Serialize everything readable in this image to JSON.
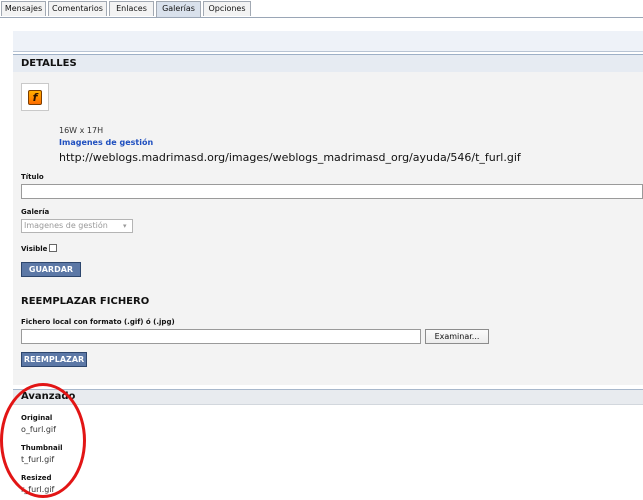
{
  "tabs": [
    {
      "label": "Mensajes"
    },
    {
      "label": "Comentarios"
    },
    {
      "label": "Enlaces"
    },
    {
      "label": "Galerías"
    },
    {
      "label": "Opciones"
    }
  ],
  "details": {
    "title": "DETALLES",
    "dimensions": "16W x 17H",
    "gallery_link": "Imagenes de gestión",
    "image_url": "http://weblogs.madrimasd.org/images/weblogs_madrimasd_org/ayuda/546/t_furl.gif"
  },
  "form": {
    "title_label": "Título",
    "title_value": "",
    "gallery_label": "Galería",
    "gallery_selected": "Imagenes de gestión",
    "visible_label": "Visible",
    "save_button": "GUARDAR"
  },
  "replace": {
    "title": "REEMPLAZAR FICHERO",
    "file_label": "Fichero local con formato (.gif) ó (.jpg)",
    "browse_button": "Examinar...",
    "replace_button": "REEMPLAZAR"
  },
  "advanced": {
    "title": "Avanzado",
    "original_label": "Original",
    "original_value": "o_furl.gif",
    "thumbnail_label": "Thumbnail",
    "thumbnail_value": "t_furl.gif",
    "resized_label": "Resized",
    "resized_value": "r_furl.gif"
  },
  "icons": {
    "thumbnail": "furl-icon",
    "dropdown": "chevron-down-icon"
  },
  "colors": {
    "accent_button": "#5c78a6",
    "link": "#1f4fbf",
    "annotation": "#e21515"
  }
}
